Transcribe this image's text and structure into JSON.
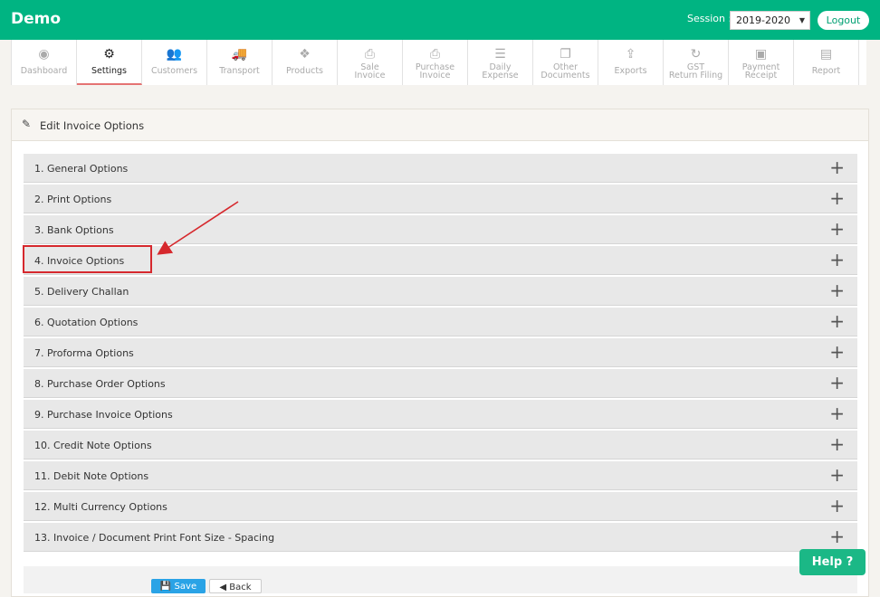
{
  "header": {
    "brand": "Demo",
    "session_label": "Session :",
    "session_value": "2019-2020",
    "logout_label": "Logout"
  },
  "nav": {
    "items": [
      {
        "key": "dashboard",
        "label": "Dashboard",
        "icon": "dashboard-icon",
        "glyph": "◉"
      },
      {
        "key": "settings",
        "label": "Settings",
        "icon": "gear-icon",
        "glyph": "⚙"
      },
      {
        "key": "customers",
        "label": "Customers",
        "icon": "users-icon",
        "glyph": "👥"
      },
      {
        "key": "transport",
        "label": "Transport",
        "icon": "truck-icon",
        "glyph": "🚚"
      },
      {
        "key": "products",
        "label": "Products",
        "icon": "cubes-icon",
        "glyph": "❖"
      },
      {
        "key": "sale-invoice",
        "label": "Sale\nInvoice",
        "icon": "print-icon",
        "glyph": "⎙"
      },
      {
        "key": "purchase-invoice",
        "label": "Purchase\nInvoice",
        "icon": "print-icon",
        "glyph": "⎙"
      },
      {
        "key": "daily-expense",
        "label": "Daily\nExpense",
        "icon": "list-icon",
        "glyph": "☰"
      },
      {
        "key": "other-documents",
        "label": "Other\nDocuments",
        "icon": "copy-icon",
        "glyph": "❐"
      },
      {
        "key": "exports",
        "label": "Exports",
        "icon": "upload-icon",
        "glyph": "⇪"
      },
      {
        "key": "gst-return-filing",
        "label": "GST\nReturn Filing",
        "icon": "refresh-icon",
        "glyph": "↻"
      },
      {
        "key": "payment-receipt",
        "label": "Payment\nReceipt",
        "icon": "money-icon",
        "glyph": "▣"
      },
      {
        "key": "report",
        "label": "Report",
        "icon": "newspaper-icon",
        "glyph": "▤"
      }
    ],
    "active": "settings"
  },
  "panel": {
    "title": "Edit Invoice Options",
    "options": [
      "1. General Options",
      "2. Print Options",
      "3. Bank Options",
      "4. Invoice Options",
      "5. Delivery Challan",
      "6. Quotation Options",
      "7. Proforma Options",
      "8. Purchase Order Options",
      "9. Purchase Invoice Options",
      "10. Credit Note Options",
      "11. Debit Note Options",
      "12. Multi Currency Options",
      "13. Invoice / Document Print Font Size - Spacing"
    ],
    "save_label": "Save",
    "back_label": "Back"
  },
  "help_label": "Help ?"
}
